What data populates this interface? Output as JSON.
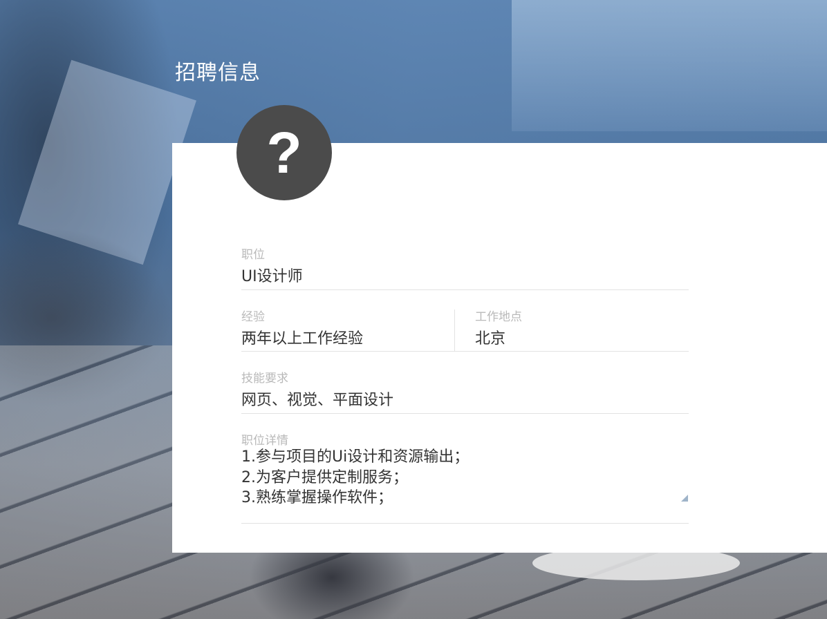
{
  "header": {
    "title": "招聘信息"
  },
  "avatar": {
    "glyph": "?",
    "icon": "question-mark-icon"
  },
  "form": {
    "position": {
      "label": "职位",
      "value": "UI设计师"
    },
    "experience": {
      "label": "经验",
      "value": "两年以上工作经验"
    },
    "location": {
      "label": "工作地点",
      "value": "北京"
    },
    "skills": {
      "label": "技能要求",
      "value": "网页、视觉、平面设计"
    },
    "details": {
      "label": "职位详情",
      "value": "1.参与项目的Ui设计和资源输出；\n2.为客户提供定制服务；\n3.熟练掌握操作软件；"
    }
  },
  "colors": {
    "card_background": "#ffffff",
    "avatar_background": "#4b4b4b",
    "label_text": "#b9b9b9",
    "value_text": "#333333",
    "divider": "#e2e2e2"
  }
}
